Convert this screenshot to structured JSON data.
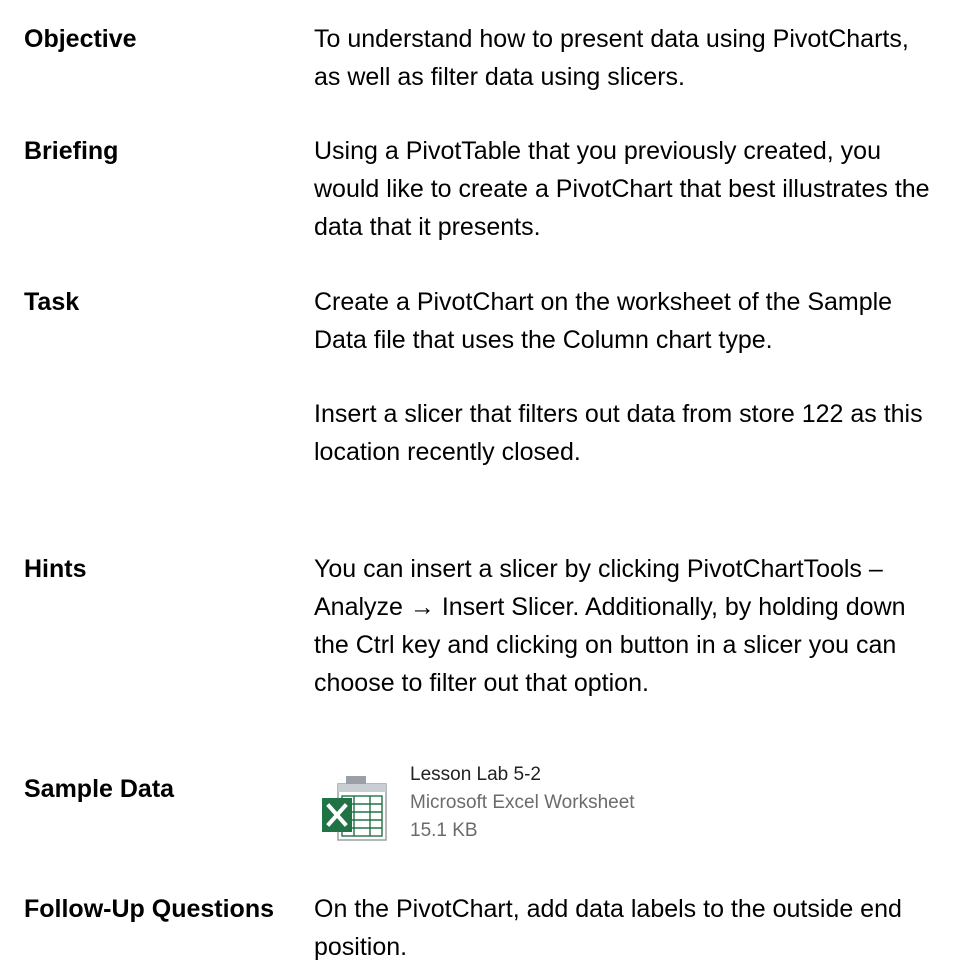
{
  "rows": {
    "objective": {
      "label": "Objective",
      "paragraphs": [
        "To understand how to present data using PivotCharts, as well as filter data using slicers."
      ]
    },
    "briefing": {
      "label": "Briefing",
      "paragraphs": [
        "Using a PivotTable that you previously created, you would like to create a PivotChart that best illustrates the data that it presents."
      ]
    },
    "task": {
      "label": "Task",
      "paragraphs": [
        "Create a PivotChart on the worksheet of the Sample Data file that uses the Column chart type.",
        "Insert a slicer that filters out data from store 122 as this location recently closed."
      ]
    },
    "hints": {
      "label": "Hints",
      "paragraphs": [
        "You can insert a slicer by clicking PivotChartTools – Analyze → Insert Slicer. Additionally, by holding down the Ctrl key and clicking on button in a slicer you can choose to filter out that option."
      ]
    },
    "sample_data": {
      "label": "Sample Data",
      "file": {
        "name": "Lesson Lab 5-2",
        "type": "Microsoft Excel Worksheet",
        "size": "15.1 KB",
        "icon": "excel-file-icon",
        "brand_color": "#217346"
      }
    },
    "follow_up": {
      "label": "Follow-Up Questions",
      "paragraphs": [
        "On the PivotChart, add data labels to the outside end position."
      ]
    }
  }
}
